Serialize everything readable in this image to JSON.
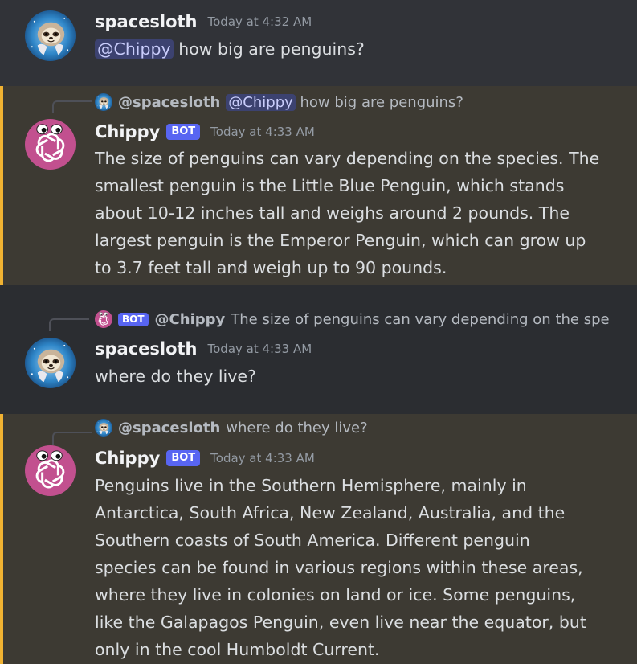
{
  "messages": [
    {
      "author": "spacesloth",
      "timestamp": "Today at 4:32 AM",
      "mention": "@Chippy",
      "text": "how big are penguins?"
    },
    {
      "reply": {
        "author": "@spacesloth",
        "mention": "@Chippy",
        "text": "how big are penguins?"
      },
      "author": "Chippy",
      "bot_tag": "BOT",
      "timestamp": "Today at 4:33 AM",
      "lines": [
        "The size of penguins can vary depending on the species. The",
        "smallest penguin is the Little Blue Penguin, which stands",
        "about 10-12 inches tall and weighs around 2 pounds. The",
        "largest penguin is the Emperor Penguin, which can grow up",
        "to 3.7 feet tall and weigh up to 90 pounds."
      ]
    },
    {
      "reply": {
        "bot_tag": "BOT",
        "author": "@Chippy",
        "text": "The size of penguins can vary depending on the spe"
      },
      "author": "spacesloth",
      "timestamp": "Today at 4:33 AM",
      "text": "where do they live?"
    },
    {
      "reply": {
        "author": "@spacesloth",
        "text": "where do they live?"
      },
      "author": "Chippy",
      "bot_tag": "BOT",
      "timestamp": "Today at 4:33 AM",
      "lines": [
        "Penguins live in the Southern Hemisphere, mainly in",
        "Antarctica, South Africa, New Zealand, Australia, and the",
        "Southern coasts of South America. Different penguin",
        "species can be found in various regions within these areas,",
        "where they live in colonies on land or ice. Some penguins,",
        "like the Galapagos Penguin, even live near the equator, but",
        "only in the cool Humboldt Current."
      ]
    }
  ],
  "colors": {
    "background": "#313338",
    "mention_highlight": "#3d3a33",
    "mention_border": "#f0b232",
    "bot_tag": "#5865f2",
    "mention_pill": "#3c4270"
  },
  "icons": {
    "user_avatar": "sloth-avatar-icon",
    "bot_avatar": "openai-logo-avatar-icon"
  }
}
